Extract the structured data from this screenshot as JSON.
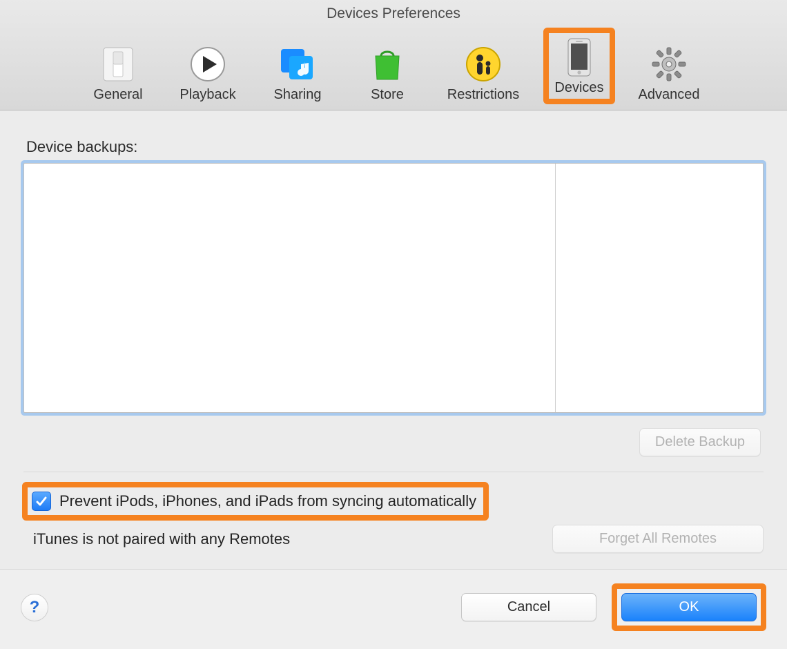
{
  "window": {
    "title": "Devices Preferences"
  },
  "toolbar": {
    "items": [
      {
        "label": "General"
      },
      {
        "label": "Playback"
      },
      {
        "label": "Sharing"
      },
      {
        "label": "Store"
      },
      {
        "label": "Restrictions"
      },
      {
        "label": "Devices"
      },
      {
        "label": "Advanced"
      }
    ],
    "selected_index": 5
  },
  "body": {
    "backups_label": "Device backups:",
    "delete_backup_label": "Delete Backup",
    "prevent_sync_checked": true,
    "prevent_sync_label": "Prevent iPods, iPhones, and iPads from syncing automatically",
    "remotes_status": "iTunes is not paired with any Remotes",
    "forget_remotes_label": "Forget All Remotes"
  },
  "footer": {
    "help_label": "?",
    "cancel_label": "Cancel",
    "ok_label": "OK"
  },
  "annotations": {
    "highlight_color": "#f58220",
    "highlighted": [
      "tab-devices",
      "prevent-sync-row",
      "ok-button"
    ]
  }
}
